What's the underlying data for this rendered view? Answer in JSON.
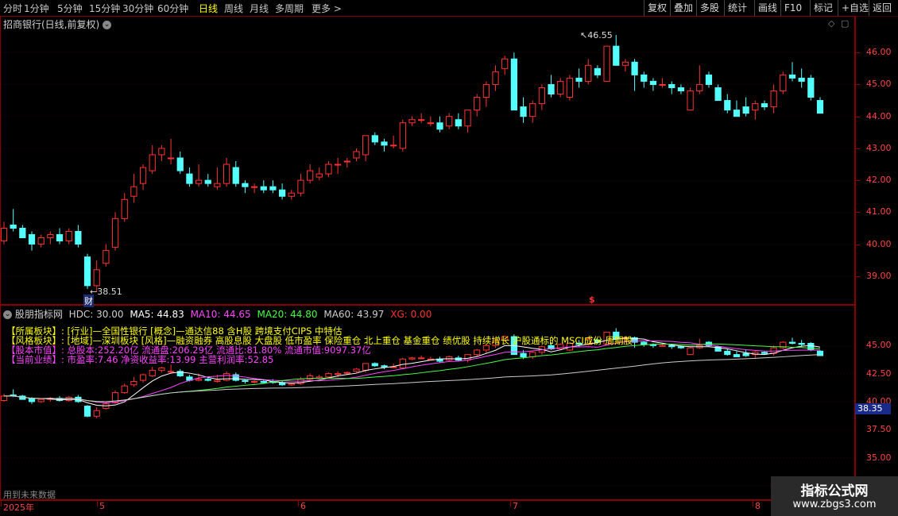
{
  "toolbar": {
    "timeframes": [
      "分时",
      "1分钟",
      "5分钟",
      "15分钟",
      "30分钟",
      "60分钟",
      "日线",
      "周线",
      "月线",
      "多周期",
      "更多 >"
    ],
    "active_timeframe": "日线",
    "right_buttons": [
      "复权",
      "叠加",
      "多股",
      "统计",
      "画线",
      "F10",
      "标记",
      "+自选",
      "返回"
    ]
  },
  "main_chart": {
    "title": "招商银行(日线,前复权)",
    "high_label": "46.55",
    "low_label": "38.51",
    "low_marker": "财",
    "dollar_marker": "$",
    "axis_ticks": [
      "46.00",
      "45.00",
      "44.00",
      "43.00",
      "42.00",
      "41.00",
      "40.00",
      "39.00"
    ]
  },
  "indicator": {
    "name": "股朋指标网",
    "hdc": "HDC: 30.00",
    "ma5": "MA5: 44.83",
    "ma10": "MA10: 44.65",
    "ma20": "MA20: 44.80",
    "ma60": "MA60: 43.97",
    "xg": "XG: 0.00",
    "axis_ticks": [
      "45.00",
      "42.50",
      "40.00",
      "37.50",
      "35.00",
      "32.50"
    ],
    "current_price": "38.35",
    "info_lines": [
      {
        "label": "【所属板块】:",
        "text": "[行业]—全国性银行 [概念]—通达信88 含H股 跨境支付CIPS 中特估"
      },
      {
        "label": "【风格板块】:",
        "text": "[地域]—深圳板块 [风格]—融资融券 高股息股 大盘股 低市盈率 保险重仓 北上重仓 基金重仓 绩优股 持续增长 沪股通标的 MSCI成份 周期股"
      },
      {
        "label": "【股本市值】:",
        "text": "总股本:252.20亿 流通盘:206.29亿 流通比:81.80% 流通市值:9097.37亿"
      },
      {
        "label": "【当前业绩】:",
        "text": "市盈率:7.46 净资收益率:13.99 主营利润率:52.85"
      }
    ],
    "footer_text": "用到未来数据"
  },
  "dates": [
    "2025年",
    "5",
    "6",
    "7",
    "8"
  ],
  "watermark": {
    "line1": "指标公式网",
    "line2": "www.zbgs3.com"
  },
  "colors": {
    "up": "#ff3333",
    "down": "#54ffff",
    "ma5": "#ffffff",
    "ma10": "#ff44ff",
    "ma20": "#44ff44",
    "ma60": "#cccccc",
    "text_yellow": "#ffff00",
    "border": "#8b0000"
  },
  "chart_data": {
    "type": "candlestick",
    "ylim_main": [
      38.2,
      46.9
    ],
    "ylim_indicator": [
      31.5,
      47.5
    ],
    "candles": [
      [
        40.1,
        40.7,
        40.0,
        40.5
      ],
      [
        40.6,
        41.1,
        40.4,
        40.5
      ],
      [
        40.5,
        40.6,
        40.2,
        40.2
      ],
      [
        40.3,
        40.4,
        39.8,
        40.0
      ],
      [
        40.0,
        40.3,
        39.9,
        40.2
      ],
      [
        40.2,
        40.4,
        40.0,
        40.3
      ],
      [
        40.3,
        40.5,
        40.0,
        40.1
      ],
      [
        40.1,
        40.5,
        40.0,
        40.4
      ],
      [
        40.4,
        40.6,
        39.9,
        40.0
      ],
      [
        39.6,
        39.7,
        38.6,
        38.7
      ],
      [
        38.7,
        39.5,
        38.5,
        39.2
      ],
      [
        39.4,
        40.0,
        39.3,
        39.8
      ],
      [
        39.9,
        41.0,
        39.8,
        40.8
      ],
      [
        40.8,
        41.6,
        40.7,
        41.4
      ],
      [
        41.5,
        42.2,
        41.3,
        41.8
      ],
      [
        41.9,
        42.5,
        41.7,
        42.4
      ],
      [
        42.3,
        43.1,
        42.2,
        42.8
      ],
      [
        42.8,
        43.1,
        42.6,
        43.0
      ],
      [
        42.7,
        43.3,
        42.5,
        42.7
      ],
      [
        42.7,
        42.9,
        42.2,
        42.3
      ],
      [
        42.2,
        42.4,
        41.8,
        41.9
      ],
      [
        41.9,
        42.5,
        41.8,
        42.0
      ],
      [
        42.0,
        42.2,
        41.8,
        41.9
      ],
      [
        41.8,
        42.4,
        41.7,
        41.9
      ],
      [
        41.9,
        42.7,
        41.8,
        42.5
      ],
      [
        42.4,
        42.6,
        41.8,
        41.9
      ],
      [
        41.9,
        42.0,
        41.6,
        41.8
      ],
      [
        41.8,
        41.9,
        41.6,
        41.8
      ],
      [
        41.8,
        42.0,
        41.6,
        41.7
      ],
      [
        41.8,
        42.0,
        41.6,
        41.7
      ],
      [
        41.7,
        41.9,
        41.4,
        41.5
      ],
      [
        41.5,
        41.7,
        41.4,
        41.6
      ],
      [
        41.6,
        42.2,
        41.5,
        42.0
      ],
      [
        42.0,
        42.5,
        41.9,
        42.3
      ],
      [
        42.1,
        42.4,
        42.0,
        42.2
      ],
      [
        42.2,
        42.6,
        42.1,
        42.5
      ],
      [
        42.5,
        42.7,
        42.2,
        42.5
      ],
      [
        42.6,
        42.7,
        42.4,
        42.6
      ],
      [
        42.7,
        43.0,
        42.6,
        42.9
      ],
      [
        42.8,
        43.4,
        42.6,
        43.4
      ],
      [
        43.4,
        43.5,
        43.1,
        43.2
      ],
      [
        43.2,
        43.3,
        42.9,
        43.1
      ],
      [
        43.1,
        43.4,
        43.0,
        43.1
      ],
      [
        43.0,
        43.9,
        42.9,
        43.8
      ],
      [
        43.8,
        44.0,
        43.7,
        43.9
      ],
      [
        43.9,
        44.1,
        43.8,
        43.9
      ],
      [
        43.8,
        44.0,
        43.7,
        43.8
      ],
      [
        43.8,
        44.0,
        43.5,
        43.6
      ],
      [
        43.7,
        44.1,
        43.6,
        44.0
      ],
      [
        43.9,
        44.1,
        43.6,
        43.7
      ],
      [
        43.7,
        44.2,
        43.5,
        44.2
      ],
      [
        44.2,
        44.7,
        44.0,
        44.6
      ],
      [
        44.6,
        45.1,
        44.3,
        45.0
      ],
      [
        45.0,
        45.6,
        44.8,
        45.4
      ],
      [
        45.5,
        45.9,
        45.3,
        45.8
      ],
      [
        45.8,
        46.0,
        44.2,
        44.2
      ],
      [
        44.3,
        44.6,
        43.8,
        44.0
      ],
      [
        44.0,
        44.5,
        43.8,
        44.4
      ],
      [
        44.4,
        45.0,
        44.2,
        44.9
      ],
      [
        45.0,
        45.3,
        44.6,
        44.7
      ],
      [
        44.7,
        45.2,
        44.6,
        45.1
      ],
      [
        44.6,
        45.3,
        44.5,
        45.2
      ],
      [
        45.2,
        45.5,
        44.9,
        45.1
      ],
      [
        45.1,
        45.8,
        45.0,
        45.6
      ],
      [
        45.5,
        45.6,
        45.2,
        45.3
      ],
      [
        45.1,
        46.0,
        45.1,
        46.2
      ],
      [
        46.2,
        46.55,
        45.6,
        45.6
      ],
      [
        45.6,
        45.8,
        45.4,
        45.7
      ],
      [
        45.7,
        45.8,
        44.8,
        45.3
      ],
      [
        45.3,
        45.4,
        44.9,
        45.1
      ],
      [
        45.1,
        45.2,
        44.8,
        45.0
      ],
      [
        45.0,
        45.2,
        44.9,
        45.0
      ],
      [
        45.0,
        45.1,
        44.7,
        44.9
      ],
      [
        44.9,
        45.0,
        44.7,
        44.8
      ],
      [
        44.2,
        44.9,
        44.2,
        44.8
      ],
      [
        44.8,
        45.6,
        44.7,
        45.0
      ],
      [
        45.3,
        45.4,
        44.9,
        45.0
      ],
      [
        44.9,
        45.0,
        44.5,
        44.5
      ],
      [
        44.5,
        44.7,
        44.1,
        44.2
      ],
      [
        44.2,
        44.5,
        44.0,
        44.0
      ],
      [
        44.3,
        44.6,
        44.0,
        44.1
      ],
      [
        44.2,
        44.5,
        43.9,
        44.4
      ],
      [
        44.4,
        44.5,
        44.2,
        44.3
      ],
      [
        44.3,
        45.0,
        44.1,
        44.8
      ],
      [
        44.8,
        45.4,
        44.7,
        45.3
      ],
      [
        45.3,
        45.7,
        45.1,
        45.2
      ],
      [
        45.2,
        45.5,
        44.9,
        45.1
      ],
      [
        45.2,
        45.3,
        44.5,
        44.6
      ],
      [
        44.5,
        44.6,
        44.1,
        44.1
      ]
    ]
  }
}
